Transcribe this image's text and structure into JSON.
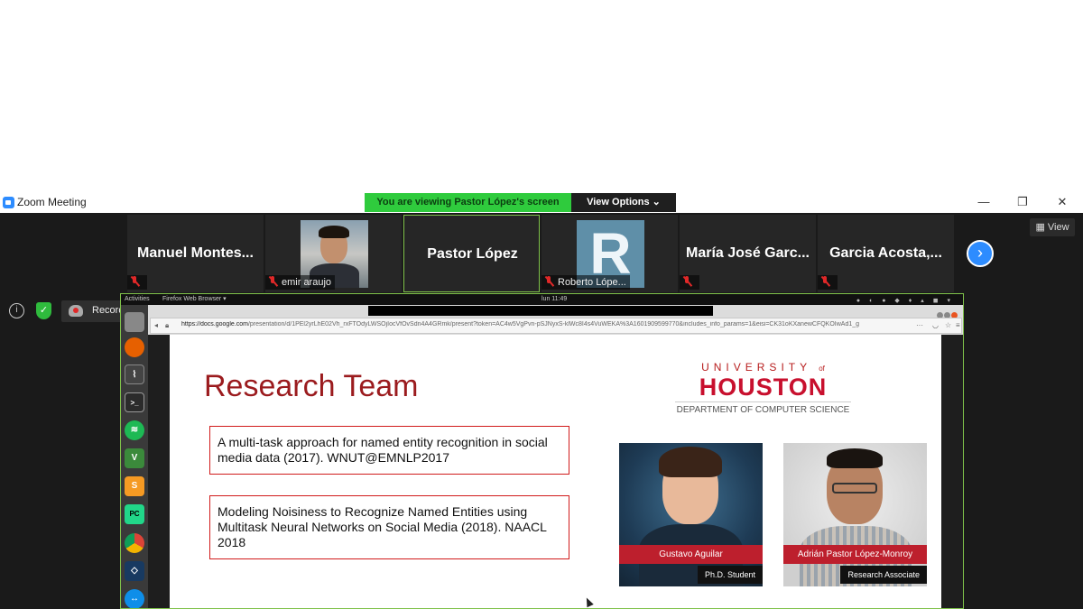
{
  "window": {
    "title": "Zoom Meeting",
    "banner_text": "You are viewing Pastor López's screen",
    "view_options_label": "View Options",
    "minimize_icon": "minimize-icon",
    "restore_icon": "restore-icon",
    "close_icon": "close-icon"
  },
  "participants": [
    {
      "name": "Manuel  Montes...",
      "video": false,
      "muted": true
    },
    {
      "name": "emir araujo",
      "video": true,
      "muted": true
    },
    {
      "name": "Pastor López",
      "video": false,
      "muted": false,
      "active_speaker": true
    },
    {
      "name": "Roberto Lópe...",
      "video": true,
      "avatar_letter": "R",
      "muted": true
    },
    {
      "name": "María José  Garc...",
      "video": false,
      "muted": true
    },
    {
      "name": "Garcia  Acosta,...",
      "video": false,
      "muted": true
    }
  ],
  "view_button_label": "View",
  "recording": {
    "label": "Recording...",
    "pause_label": "❚❚"
  },
  "shared_screen": {
    "topbar_activities": "Activities",
    "topbar_app": "Firefox Web Browser ▾",
    "clock": "lun 11:49",
    "url_host": "https://docs.google.com",
    "url_rest": "/presentation/d/1PEl2yrLhE02Vh_rxFTOdyLWSOjIocVfOvSdn4A4GRmk/present?token=AC4w5VgPvn-pSJNyxS-klWc8I4s4VuWEKA%3A1601909599770&includes_info_params=1&eisi=CK31oKXanewCFQKOIwAd1_g",
    "dock_icons": [
      "files-icon",
      "firefox-icon",
      "system-monitor-icon",
      "terminal-icon",
      "spotify-icon",
      "vim-icon",
      "sublime-icon",
      "pycharm-icon",
      "chrome-icon",
      "virtualbox-icon",
      "teamviewer-icon"
    ]
  },
  "slide": {
    "title": "Research Team",
    "logo": {
      "line1": "UNIVERSITY",
      "line1_small": "of",
      "line2": "HOUSTON",
      "line3": "DEPARTMENT OF COMPUTER SCIENCE"
    },
    "publications": [
      "A multi-task approach for named entity recognition in social media data (2017). WNUT@EMNLP2017",
      "Modeling Noisiness to Recognize Named Entities using Multitask Neural Networks on Social Media (2018). NAACL 2018"
    ],
    "people": [
      {
        "name": "Gustavo Aguilar",
        "role": "Ph.D. Student"
      },
      {
        "name": "Adrián Pastor López-Monroy",
        "role": "Research Associate"
      }
    ]
  },
  "colors": {
    "banner_green": "#2fcb3d",
    "zoom_blue": "#2d8cff",
    "slide_title_red": "#9b1b1e",
    "uh_red": "#c8102e",
    "box_border_red": "#d11b1b"
  }
}
